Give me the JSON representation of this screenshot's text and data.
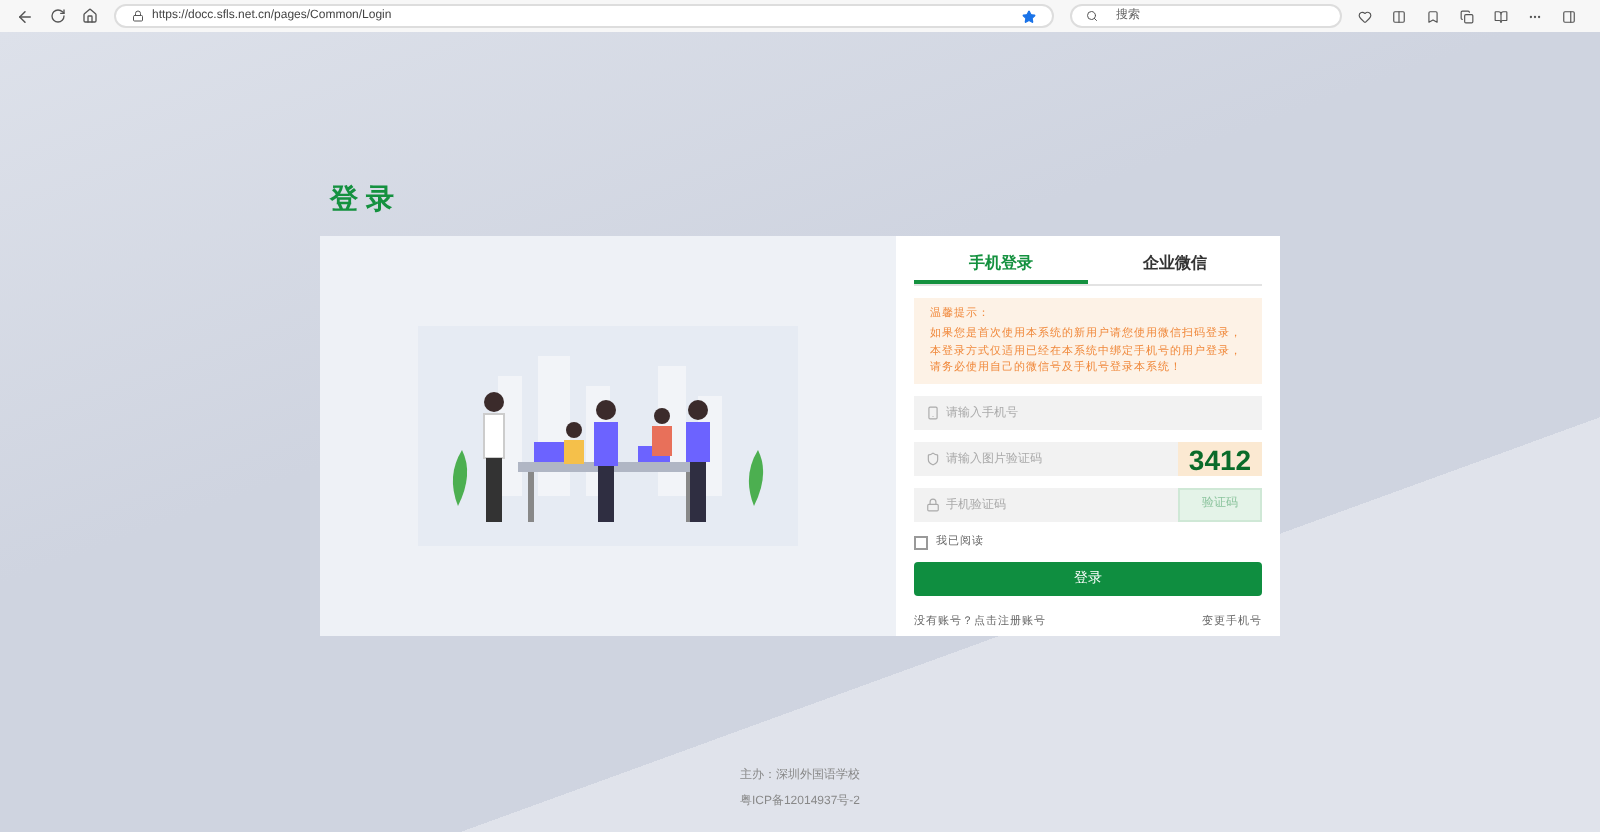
{
  "browser": {
    "url": "https://docc.sfls.net.cn/pages/Common/Login",
    "search_placeholder": "搜索"
  },
  "title": "登 录",
  "tabs": [
    {
      "label": "手机登录",
      "selected": true
    },
    {
      "label": "企业微信",
      "selected": false
    }
  ],
  "notice": {
    "title": "温馨提示：",
    "text": "如果您是首次使用本系统的新用户请您使用微信扫码登录，本登录方式仅适用已经在本系统中绑定手机号的用户登录，请务必使用自己的微信号及手机号登录本系统！"
  },
  "fields": [
    {
      "kind": "phone",
      "placeholder": "请输入手机号"
    },
    {
      "kind": "captcha",
      "placeholder": "请输入图片验证码",
      "captcha": "3412"
    },
    {
      "kind": "sms",
      "placeholder": "手机验证码",
      "button": "验证码"
    }
  ],
  "agree": {
    "label": "我已阅读",
    "checked": false
  },
  "login_button": "登录",
  "links": [
    "没有账号？点击注册账号",
    "变更手机号"
  ],
  "footer": [
    "主办：深圳外国语学校",
    "粤ICP备12014937号-2"
  ]
}
